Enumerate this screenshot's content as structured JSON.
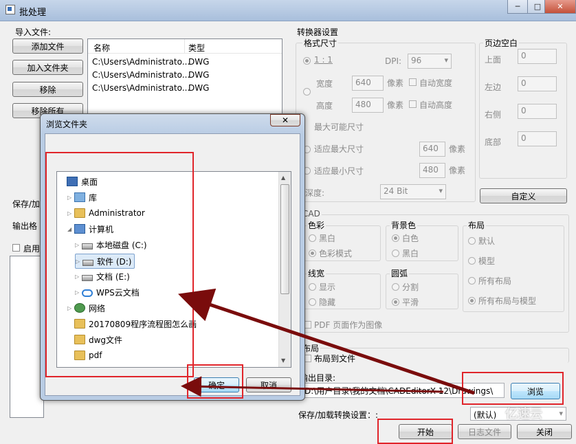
{
  "window": {
    "title": "批处理",
    "controls": {
      "minimize": "─",
      "maximize": "□",
      "close": "✕"
    }
  },
  "import": {
    "label": "导入文件:",
    "add_file": "添加文件",
    "add_folder": "加入文件夹",
    "remove": "移除",
    "remove_all": "移除所有",
    "columns": [
      "名称",
      "类型"
    ],
    "rows": [
      {
        "name": "C:\\Users\\Administrato...",
        "type": "DWG"
      },
      {
        "name": "C:\\Users\\Administrato...",
        "type": "DWG"
      },
      {
        "name": "C:\\Users\\Administrato...",
        "type": "DWG"
      }
    ],
    "save_load_label": "保存/加",
    "output_format_label": "输出格",
    "enable_label": "启用"
  },
  "converter": {
    "title": "转换器设置",
    "format_size": "格式尺寸",
    "ratio": "1 : 1",
    "dpi_label": "DPI:",
    "dpi_value": "96",
    "width_label": "宽度",
    "width_value": "640",
    "height_label": "高度",
    "height_value": "480",
    "pixel_unit": "像素",
    "auto_width": "自动宽度",
    "auto_height": "自动高度",
    "max_size": "最大可能尺寸",
    "fit_max": "适应最大尺寸",
    "fit_max_value": "640",
    "fit_min": "适应最小尺寸",
    "fit_min_value": "480",
    "depth_label": "深度:",
    "depth_value": "24 Bit",
    "margin_title": "页边空白",
    "margins": [
      {
        "label": "上面",
        "value": "0"
      },
      {
        "label": "左边",
        "value": "0"
      },
      {
        "label": "右侧",
        "value": "0"
      },
      {
        "label": "底部",
        "value": "0"
      }
    ],
    "custom_button": "自定义",
    "cad_title": "CAD",
    "color_title": "色彩",
    "color_opts": [
      "黑白",
      "色彩模式"
    ],
    "bg_title": "背景色",
    "bg_opts": [
      "白色",
      "黑白"
    ],
    "layout_title": "布局",
    "layout_opts": [
      "默认",
      "模型",
      "所有布局",
      "所有布局与模型"
    ],
    "lw_title": "线宽",
    "lw_opts": [
      "显示",
      "隐藏"
    ],
    "arc_title": "圆弧",
    "arc_opts": [
      "分割",
      "平滑"
    ],
    "pdf_as_image": "PDF 页面作为图像",
    "layout2_title": "布局",
    "layout_to_file": "布局到文件",
    "output_dir_label": "输出目录:",
    "output_dir_value": "D:\\用户目录\\我的文档\\CADEditorX 12\\Drawings\\",
    "browse_button": "浏览",
    "save_load_settings": "保存/加载转换设置：:",
    "settings_value": "(默认)"
  },
  "footer": {
    "start": "开始",
    "log": "日志文件",
    "close": "关闭"
  },
  "dialog": {
    "title": "浏览文件夹",
    "close": "✕",
    "tree": [
      {
        "label": "桌面",
        "icon": "desktop-icon",
        "indent": 0,
        "expander": ""
      },
      {
        "label": "库",
        "icon": "library-icon",
        "indent": 1,
        "expander": "▷"
      },
      {
        "label": "Administrator",
        "icon": "user-folder-icon",
        "indent": 1,
        "expander": "▷"
      },
      {
        "label": "计算机",
        "icon": "computer-icon",
        "indent": 1,
        "expander": "◢"
      },
      {
        "label": "本地磁盘 (C:)",
        "icon": "drive-icon",
        "indent": 2,
        "expander": "▷"
      },
      {
        "label": "软件 (D:)",
        "icon": "drive-icon",
        "indent": 2,
        "expander": "▷"
      },
      {
        "label": "文档 (E:)",
        "icon": "drive-icon",
        "indent": 2,
        "expander": "▷"
      },
      {
        "label": "WPS云文档",
        "icon": "cloud-icon",
        "indent": 2,
        "expander": "▷"
      },
      {
        "label": "网络",
        "icon": "network-icon",
        "indent": 1,
        "expander": "▷"
      },
      {
        "label": "20170809程序流程图怎么画",
        "icon": "folder-icon",
        "indent": 1,
        "expander": ""
      },
      {
        "label": "dwg文件",
        "icon": "folder-icon",
        "indent": 1,
        "expander": ""
      },
      {
        "label": "pdf",
        "icon": "folder-icon",
        "indent": 1,
        "expander": ""
      }
    ],
    "selected_index": 5,
    "ok": "确定",
    "cancel": "取消"
  },
  "annotation": {
    "watermark": "亿速云",
    "arrow_color": "#7a0c0c",
    "box_color": "#e0242a"
  }
}
